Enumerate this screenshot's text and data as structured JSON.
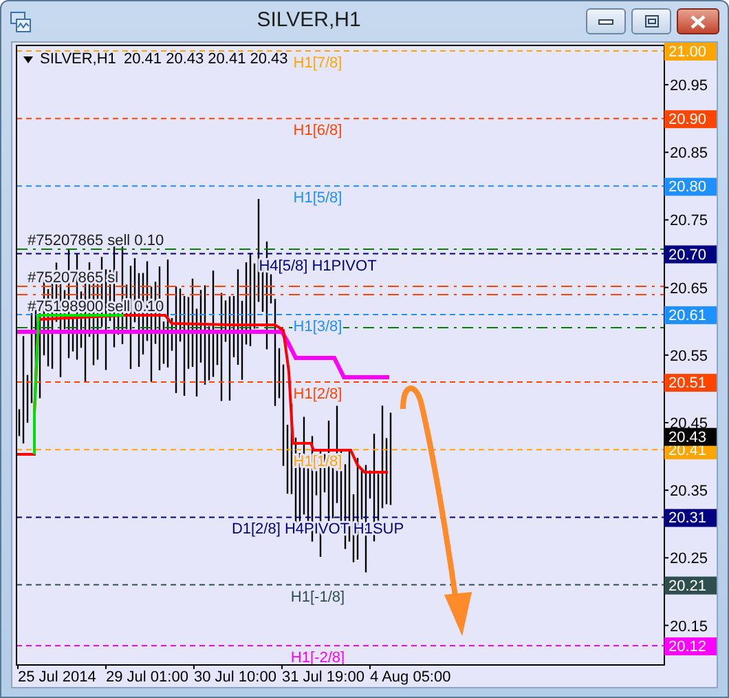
{
  "window": {
    "title": "SILVER,H1"
  },
  "chart_header": {
    "symbol": "SILVER,H1",
    "ohlc": "20.41 20.43 20.41 20.43"
  },
  "levels": [
    {
      "label": "H1[7/8]",
      "price": "21.00",
      "color": "#ffa500"
    },
    {
      "label": "H1[6/8]",
      "price": "20.90",
      "color": "#ff4500"
    },
    {
      "label": "H1[5/8]",
      "price": "20.80",
      "color": "#1e90ff"
    },
    {
      "label": "H4[5/8] H1PIVOT",
      "price": "20.70",
      "color": "#000080"
    },
    {
      "label": "H1[3/8]",
      "price": "20.61",
      "color": "#1e90ff"
    },
    {
      "label": "H1[2/8]",
      "price": "20.51",
      "color": "#ff4500"
    },
    {
      "label": "H1[1/8]",
      "price": "20.41",
      "color": "#ffa500"
    },
    {
      "label": "D1[2/8] H4PIVOT H1SUP",
      "price": "20.31",
      "color": "#000080"
    },
    {
      "label": "H1[-1/8]",
      "price": "20.21",
      "color": "#2f4f4f"
    },
    {
      "label": "H1[-2/8]",
      "price": "20.12",
      "color": "#ff00ff"
    }
  ],
  "orders": [
    {
      "label": "#75207865 sell 0.10",
      "kind": "entry"
    },
    {
      "label": "#75207865 sl",
      "kind": "stop"
    },
    {
      "label": "#75198900 sell 0.10",
      "kind": "entry"
    }
  ],
  "current_price": "20.43",
  "price_axis": [
    "20.95",
    "20.85",
    "20.75",
    "20.65",
    "20.55",
    "20.45",
    "20.35",
    "20.25",
    "20.15"
  ],
  "time_axis": [
    "25 Jul 2014",
    "29 Jul 01:00",
    "30 Jul 10:00",
    "31 Jul 19:00",
    "4 Aug 05:00"
  ]
}
